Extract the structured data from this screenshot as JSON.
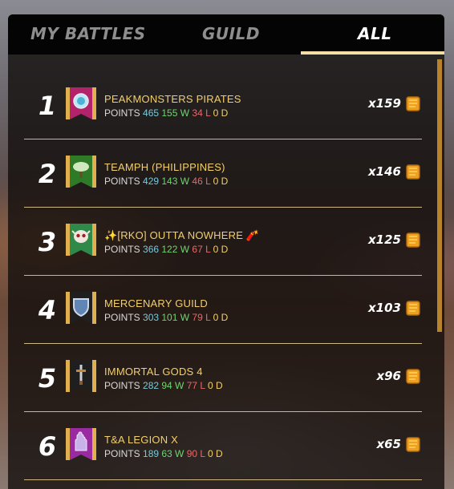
{
  "tabs": [
    {
      "label": "MY BATTLES",
      "active": false
    },
    {
      "label": "GUILD",
      "active": false
    },
    {
      "label": "ALL",
      "active": true
    }
  ],
  "colors": {
    "accent": "#f5dfa6",
    "name": "#f2cf6a",
    "points": "#7dc8d8",
    "wins": "#6fd46f",
    "losses": "#e56a6a",
    "draws": "#f2cf6a",
    "scrollbar": "#b8832a"
  },
  "stat_labels": {
    "points": "POINTS",
    "wins": "W",
    "losses": "L",
    "draws": "D"
  },
  "rows": [
    {
      "rank": "1",
      "name": "PEAKMONSTERS PIRATES",
      "points": "465",
      "wins": "155",
      "losses": "34",
      "draws": "0",
      "reward": "x159",
      "icon": "orb-icon",
      "banner_color": "#b3236b"
    },
    {
      "rank": "2",
      "name": "TEAMPH (PHILIPPINES)",
      "points": "429",
      "wins": "143",
      "losses": "46",
      "draws": "0",
      "reward": "x146",
      "icon": "tree-icon",
      "banner_color": "#2f7a26"
    },
    {
      "rank": "3",
      "name": "✨[RKO] OUTTA NOWHERE 🧨",
      "points": "366",
      "wins": "122",
      "losses": "67",
      "draws": "0",
      "reward": "x125",
      "icon": "skull-icon",
      "banner_color": "#2f8a4a"
    },
    {
      "rank": "4",
      "name": "MERCENARY GUILD",
      "points": "303",
      "wins": "101",
      "losses": "79",
      "draws": "0",
      "reward": "x103",
      "icon": "shield-icon",
      "banner_color": "#1f1f1f"
    },
    {
      "rank": "5",
      "name": "IMMORTAL GODS 4",
      "points": "282",
      "wins": "94",
      "losses": "77",
      "draws": "0",
      "reward": "x96",
      "icon": "sword-icon",
      "banner_color": "#1f1f1f"
    },
    {
      "rank": "6",
      "name": "T&A LEGION X",
      "points": "189",
      "wins": "63",
      "losses": "90",
      "draws": "0",
      "reward": "x65",
      "icon": "hand-icon",
      "banner_color": "#9a2aa0"
    }
  ]
}
